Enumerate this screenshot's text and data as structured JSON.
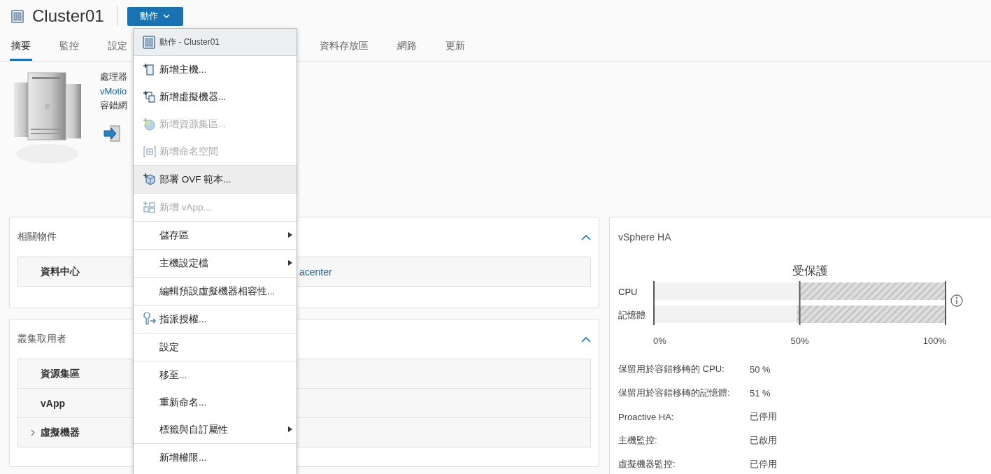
{
  "header": {
    "title": "Cluster01",
    "actions_button": "動作"
  },
  "tabs": [
    {
      "label": "摘要",
      "selected": true
    },
    {
      "label": "監控",
      "selected": false
    },
    {
      "label": "設定",
      "selected": false
    },
    {
      "label": "資料存放區",
      "selected": false
    },
    {
      "label": "網路",
      "selected": false
    },
    {
      "label": "更新",
      "selected": false
    }
  ],
  "summary": {
    "lines": [
      {
        "text": "處理器",
        "kind": "text"
      },
      {
        "text": "vMotio",
        "kind": "link"
      },
      {
        "text": "容錯網",
        "kind": "text"
      }
    ]
  },
  "cards": [
    {
      "title": "相關物件",
      "expanded": true,
      "rows": [
        {
          "label": "資料中心",
          "value": "acenter",
          "expandable": false
        }
      ]
    },
    {
      "title": "叢集取用者",
      "expanded": true,
      "rows": [
        {
          "label": "資源集區",
          "expandable": false
        },
        {
          "label": "vApp",
          "expandable": false
        },
        {
          "label": "虛擬機器",
          "expandable": true
        }
      ]
    }
  ],
  "ha": {
    "title": "vSphere HA",
    "chart_data": {
      "type": "bar",
      "orientation": "horizontal",
      "stacked": true,
      "title": "受保護",
      "categories": [
        "CPU",
        "記憶體"
      ],
      "series": [
        {
          "color": "#f2f2f2",
          "values": [
            50,
            49
          ]
        },
        {
          "color": "#dedede",
          "values": [
            50,
            51
          ]
        }
      ],
      "xlim": [
        0,
        100
      ],
      "xticks": [
        {
          "value": 0,
          "label": "0%"
        },
        {
          "value": 50,
          "label": "50%"
        },
        {
          "value": 100,
          "label": "100%"
        }
      ]
    },
    "rows": [
      {
        "label": "保留用於容錯移轉的 CPU:",
        "value": "50 %"
      },
      {
        "label": "保留用於容錯移轉的記憶體:",
        "value": "51 %"
      },
      {
        "label": "Proactive HA:",
        "value": "已停用"
      },
      {
        "label": "主機監控:",
        "value": "已啟用"
      },
      {
        "label": "虛擬機器監控:",
        "value": "已停用"
      }
    ]
  },
  "menu": {
    "title": "動作 - Cluster01",
    "groups": [
      [
        {
          "label": "新增主機...",
          "kind": "host",
          "disabled": false,
          "highlighted": false,
          "submenu": false
        },
        {
          "label": "新增虛擬機器...",
          "kind": "vm",
          "disabled": false,
          "highlighted": false,
          "submenu": false
        },
        {
          "label": "新增資源集區...",
          "kind": "pool",
          "disabled": true,
          "highlighted": false,
          "submenu": false
        },
        {
          "label": "新增命名空間",
          "kind": "namespace",
          "disabled": true,
          "highlighted": false,
          "submenu": false
        }
      ],
      [
        {
          "label": "部署 OVF 範本...",
          "kind": "template",
          "disabled": false,
          "highlighted": true,
          "submenu": false
        }
      ],
      [
        {
          "label": "新增 vApp...",
          "kind": "vapp",
          "disabled": true,
          "highlighted": false,
          "submenu": false
        }
      ],
      [
        {
          "label": "儲存區",
          "disabled": false,
          "highlighted": false,
          "submenu": true
        }
      ],
      [
        {
          "label": "主機設定檔",
          "disabled": false,
          "highlighted": false,
          "submenu": true
        }
      ],
      [
        {
          "label": "編輯預設虛擬機器相容性...",
          "disabled": false,
          "highlighted": false,
          "submenu": false
        }
      ],
      [
        {
          "label": "指派授權...",
          "kind": "license",
          "disabled": false,
          "highlighted": false,
          "submenu": false
        }
      ],
      [
        {
          "label": "設定",
          "disabled": false,
          "highlighted": false,
          "submenu": false
        }
      ],
      [
        {
          "label": "移至...",
          "disabled": false,
          "highlighted": false,
          "submenu": false
        },
        {
          "label": "重新命名...",
          "disabled": false,
          "highlighted": false,
          "submenu": false
        },
        {
          "label": "標籤與自訂屬性",
          "disabled": false,
          "highlighted": false,
          "submenu": true
        }
      ],
      [
        {
          "label": "新增權限...",
          "disabled": false,
          "highlighted": false,
          "submenu": false
        }
      ]
    ]
  }
}
